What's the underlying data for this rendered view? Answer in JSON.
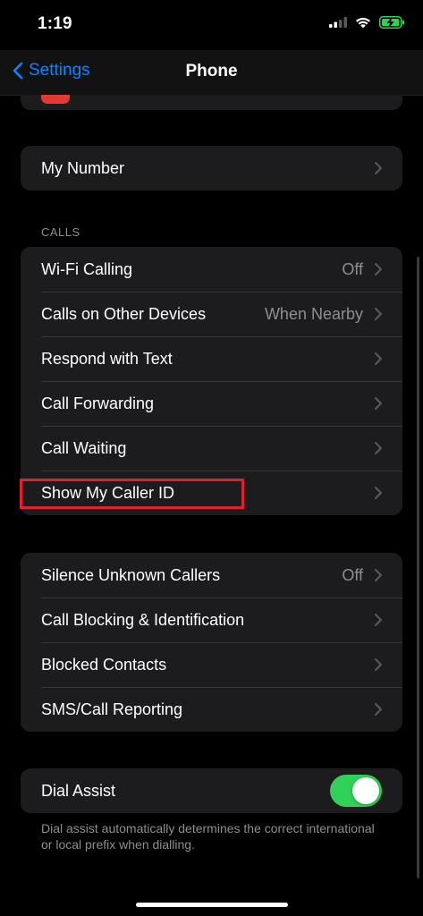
{
  "status_bar": {
    "time": "1:19"
  },
  "nav": {
    "back_label": "Settings",
    "title": "Phone"
  },
  "my_number": {
    "label": "My Number"
  },
  "calls_section": {
    "header": "CALLS",
    "rows": [
      {
        "label": "Wi-Fi Calling",
        "value": "Off"
      },
      {
        "label": "Calls on Other Devices",
        "value": "When Nearby"
      },
      {
        "label": "Respond with Text",
        "value": ""
      },
      {
        "label": "Call Forwarding",
        "value": ""
      },
      {
        "label": "Call Waiting",
        "value": ""
      },
      {
        "label": "Show My Caller ID",
        "value": ""
      }
    ]
  },
  "blocking_section": {
    "rows": [
      {
        "label": "Silence Unknown Callers",
        "value": "Off"
      },
      {
        "label": "Call Blocking & Identification",
        "value": ""
      },
      {
        "label": "Blocked Contacts",
        "value": ""
      },
      {
        "label": "SMS/Call Reporting",
        "value": ""
      }
    ]
  },
  "dial_assist": {
    "label": "Dial Assist",
    "enabled": true,
    "footer": "Dial assist automatically determines the correct international or local prefix when dialling."
  },
  "colors": {
    "accent": "#0a84ff",
    "toggle_on": "#30d158",
    "highlight": "#e0202e",
    "cell_bg": "#1c1c1e"
  }
}
